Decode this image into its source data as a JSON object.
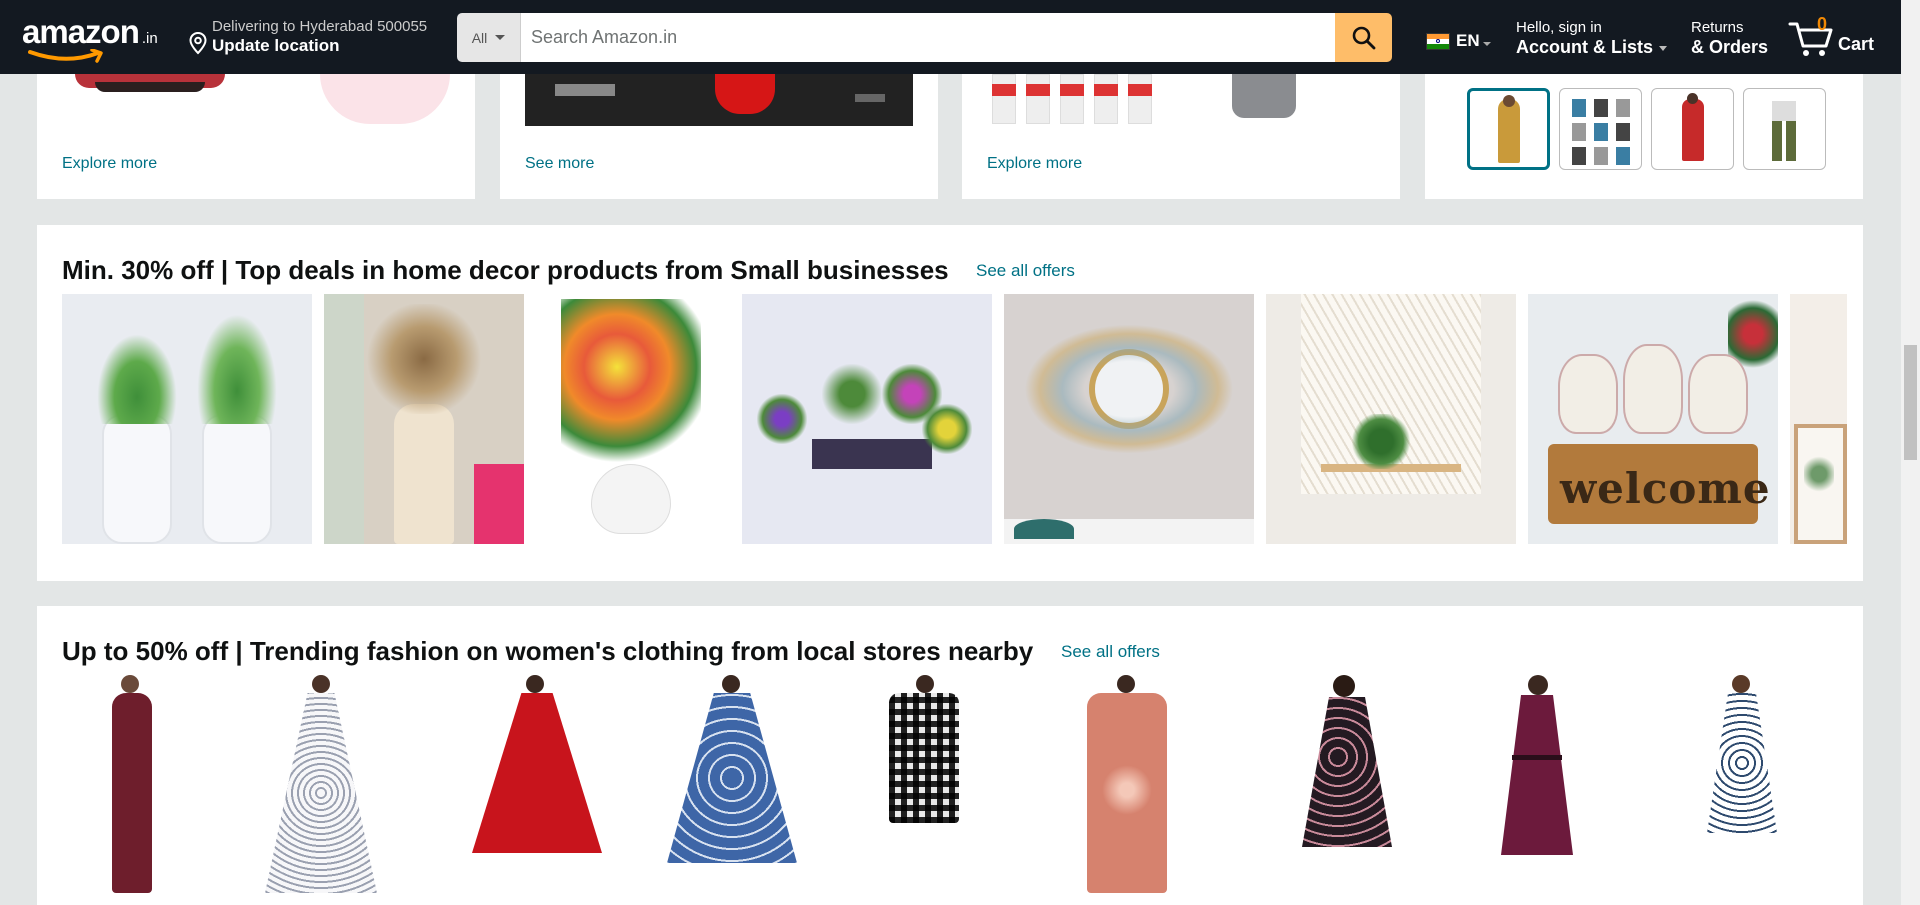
{
  "header": {
    "logo_text": "amazon",
    "logo_tld": ".in",
    "delivery_line1": "Delivering to Hyderabad 500055",
    "delivery_line2": "Update location",
    "search_category": "All",
    "search_placeholder": "Search Amazon.in",
    "language": "EN",
    "account_line1": "Hello, sign in",
    "account_line2": "Account & Lists",
    "returns_line1": "Returns",
    "returns_line2": "& Orders",
    "cart_count": "0",
    "cart_label": "Cart",
    "colors": {
      "nav_bg": "#131921",
      "search_button": "#febd69",
      "cart_count": "#f08804"
    }
  },
  "top_cards": [
    {
      "link": "Explore more"
    },
    {
      "link": "See more"
    },
    {
      "link": "Explore more"
    },
    {
      "thumbnails": [
        "saree-thumbnail",
        "socks-thumbnail",
        "red-kurta-thumbnail",
        "cargo-pants-thumbnail"
      ],
      "selected_index": 0
    }
  ],
  "section_home_decor": {
    "title": "Min. 30% off | Top deals in home decor products from Small businesses",
    "link": "See all offers",
    "products": [
      "artificial-plants-white-pots",
      "pampas-vase-decor",
      "artificial-lily-flower-pot",
      "mini-plants-set",
      "wall-mirror-decor",
      "macrame-wall-shelf",
      "welcome-puppies-figurine",
      "wall-frame-partial"
    ]
  },
  "section_fashion": {
    "title": "Up to 50% off | Trending fashion on women's clothing from local stores nearby",
    "link": "See all offers",
    "products": [
      "maroon-bodycon-dress",
      "white-printed-anarkali",
      "red-flared-dress",
      "blue-printed-dress",
      "check-shirt-dress",
      "peach-printed-kurta",
      "black-floral-dress",
      "wine-midi-dress",
      "white-floral-sleeveless-dress"
    ]
  }
}
